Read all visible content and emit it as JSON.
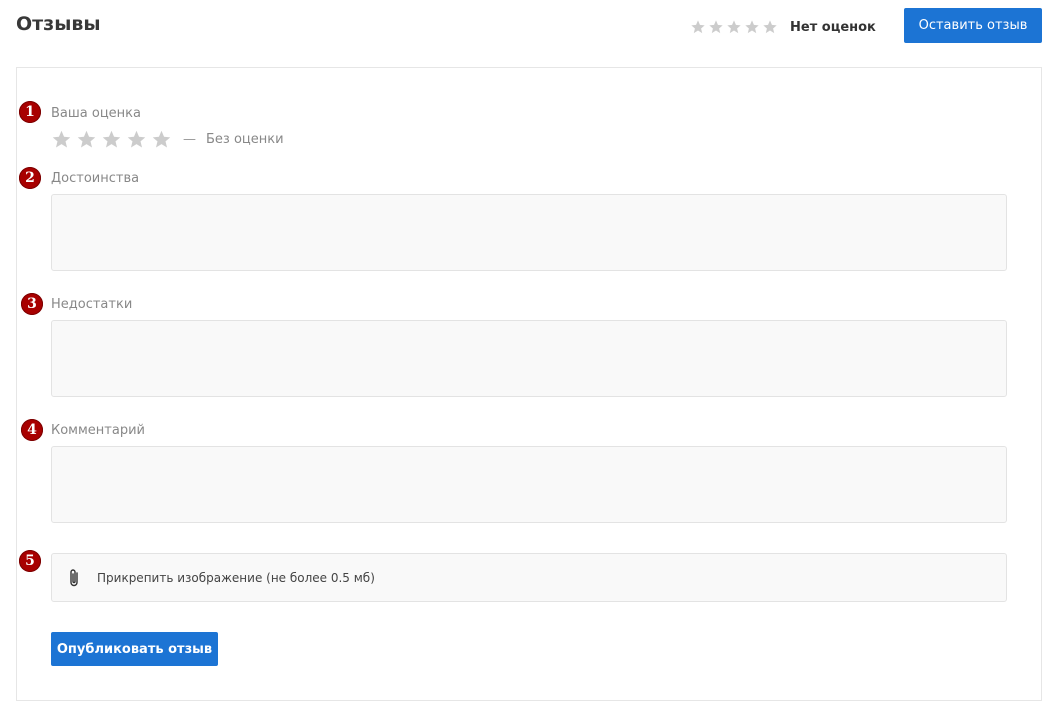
{
  "header": {
    "title": "Отзывы",
    "rating_summary": "Нет оценок",
    "leave_review_label": "Оставить отзыв"
  },
  "form": {
    "badges": [
      "1",
      "2",
      "3",
      "4",
      "5"
    ],
    "rating": {
      "label": "Ваша оценка",
      "dash": "—",
      "value_text": "Без оценки",
      "stars_filled": 0,
      "stars_total": 5
    },
    "pros": {
      "label": "Достоинства",
      "value": ""
    },
    "cons": {
      "label": "Недостатки",
      "value": ""
    },
    "comment": {
      "label": "Комментарий",
      "value": ""
    },
    "attach": {
      "label": "Прикрепить изображение (не более 0.5 мб)",
      "icon": "paperclip-icon"
    },
    "publish_label": "Опубликовать отзыв"
  },
  "colors": {
    "accent": "#1c74d4",
    "badge": "#a80000",
    "star_empty": "#cccccc",
    "field_bg": "#f9f9f9"
  }
}
